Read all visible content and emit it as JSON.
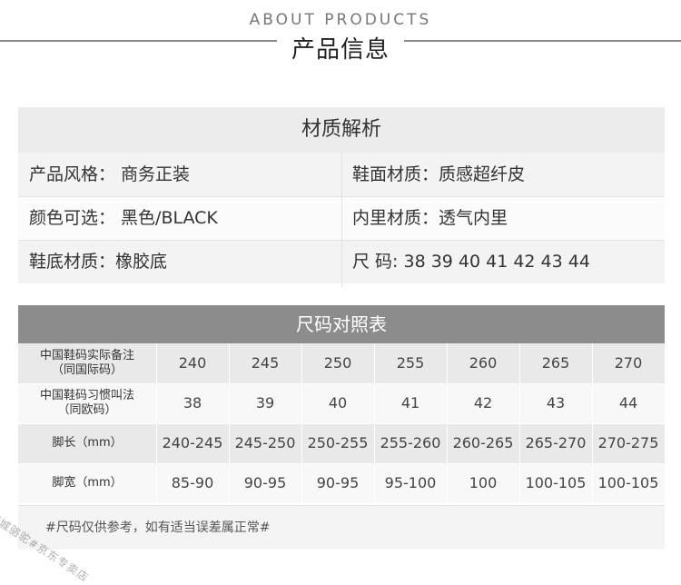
{
  "header": {
    "en_title": "ABOUT PRODUCTS",
    "cn_title": "产品信息"
  },
  "material": {
    "title": "材质解析",
    "rows": [
      {
        "left": "产品风格：  商务正装",
        "right": "鞋面材质：质感超纤皮"
      },
      {
        "left": "颜色可选：  黑色/BLACK",
        "right": "内里材质：透气内里"
      },
      {
        "left": "鞋底材质：橡胶底",
        "right": "尺        码:  38  39  40  41  42  43  44"
      }
    ]
  },
  "size_chart": {
    "title": "尺码对照表",
    "rows": [
      {
        "header_line1": "中国鞋码实际备注",
        "header_line2": "（同国际码）",
        "values": [
          "240",
          "245",
          "250",
          "255",
          "260",
          "265",
          "270"
        ]
      },
      {
        "header_line1": "中国鞋码习惯叫法",
        "header_line2": "（同欧码）",
        "values": [
          "38",
          "39",
          "40",
          "41",
          "42",
          "43",
          "44"
        ]
      },
      {
        "header_line1": "脚长（mm）",
        "header_line2": "",
        "values": [
          "240-245",
          "245-250",
          "250-255",
          "255-260",
          "260-265",
          "265-270",
          "270-275"
        ]
      },
      {
        "header_line1": "脚宽（mm）",
        "header_line2": "",
        "values": [
          "85-90",
          "90-95",
          "90-95",
          "95-100",
          "100",
          "100-105",
          "100-105"
        ]
      }
    ]
  },
  "note": "#尺码仅供参考，如有适当误差属正常#",
  "watermark": "西城骆驼#京东专卖店"
}
